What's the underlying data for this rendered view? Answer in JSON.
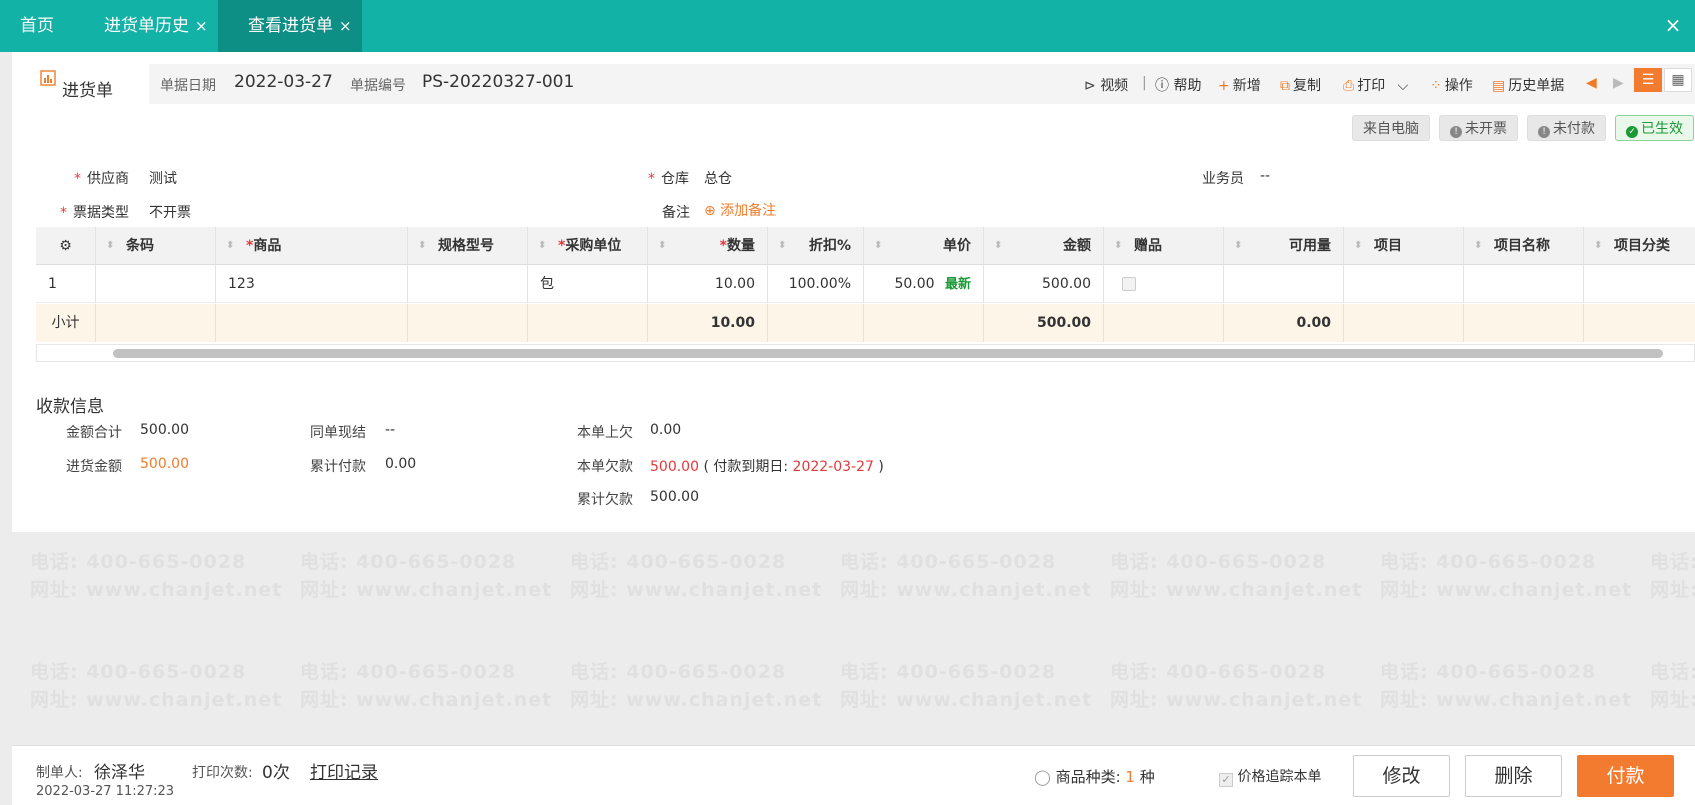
{
  "tabs": [
    {
      "label": "首页",
      "closable": false
    },
    {
      "label": "进货单历史",
      "closable": true
    },
    {
      "label": "查看进货单",
      "closable": true,
      "active": true
    }
  ],
  "close_glyph": "×",
  "watermark": {
    "phone": "电话: 400-665-0028",
    "site": "网址: www.chanjet.net"
  },
  "doc": {
    "title": "进货单",
    "date_label": "单据日期",
    "date": "2022-03-27",
    "number_label": "单据编号",
    "number": "PS-20220327-001"
  },
  "toolbar": {
    "video": "视频",
    "help": "帮助",
    "new": "新增",
    "copy": "复制",
    "print": "打印",
    "operate": "操作",
    "history": "历史单据"
  },
  "status": {
    "source": "来自电脑",
    "invoice": "未开票",
    "payment": "未付款",
    "effective": "已生效"
  },
  "form": {
    "supplier_label": "供应商",
    "supplier": "测试",
    "warehouse_label": "仓库",
    "warehouse": "总仓",
    "salesman_label": "业务员",
    "salesman": "--",
    "bill_type_label": "票据类型",
    "bill_type": "不开票",
    "note_label": "备注",
    "add_note": "添加备注"
  },
  "table": {
    "headers": [
      "条码",
      "商品",
      "规格型号",
      "采购单位",
      "数量",
      "折扣%",
      "单价",
      "金额",
      "赠品",
      "可用量",
      "项目",
      "项目名称",
      "项目分类"
    ],
    "row": {
      "index": "1",
      "barcode": "",
      "product": "123",
      "spec": "",
      "unit": "包",
      "qty": "10.00",
      "discount": "100.00%",
      "price": "50.00",
      "price_tag": "最新",
      "amount": "500.00"
    },
    "subtotal": {
      "label": "小计",
      "qty": "10.00",
      "amount": "500.00",
      "available": "0.00"
    }
  },
  "payment": {
    "title": "收款信息",
    "total_label": "金额合计",
    "total": "500.00",
    "purchase_label": "进货金额",
    "purchase": "500.00",
    "cash_label": "同单现结",
    "cash": "--",
    "paid_label": "累计付款",
    "paid": "0.00",
    "prev_label": "本单上欠",
    "prev": "0.00",
    "owe_label": "本单欠款",
    "owe": "500.00",
    "due_prefix": "( 付款到期日:",
    "due_date": "2022-03-27",
    "due_suffix": ")",
    "cum_owe_label": "累计欠款",
    "cum_owe": "500.00"
  },
  "footer": {
    "maker_label": "制单人:",
    "maker": "徐泽华",
    "print_count_label": "打印次数:",
    "print_count": "0次",
    "print_log": "打印记录",
    "timestamp": "2022-03-27 11:27:23",
    "kinds_label": "商品种类:",
    "kinds_value": "1",
    "kinds_unit": "种",
    "trace_label": "价格追踪本单",
    "edit": "修改",
    "delete": "删除",
    "pay": "付款"
  },
  "colors": {
    "teal": "#12b2a6",
    "accent": "#f37b30",
    "red": "#e4393c",
    "green": "#1a9a34"
  }
}
